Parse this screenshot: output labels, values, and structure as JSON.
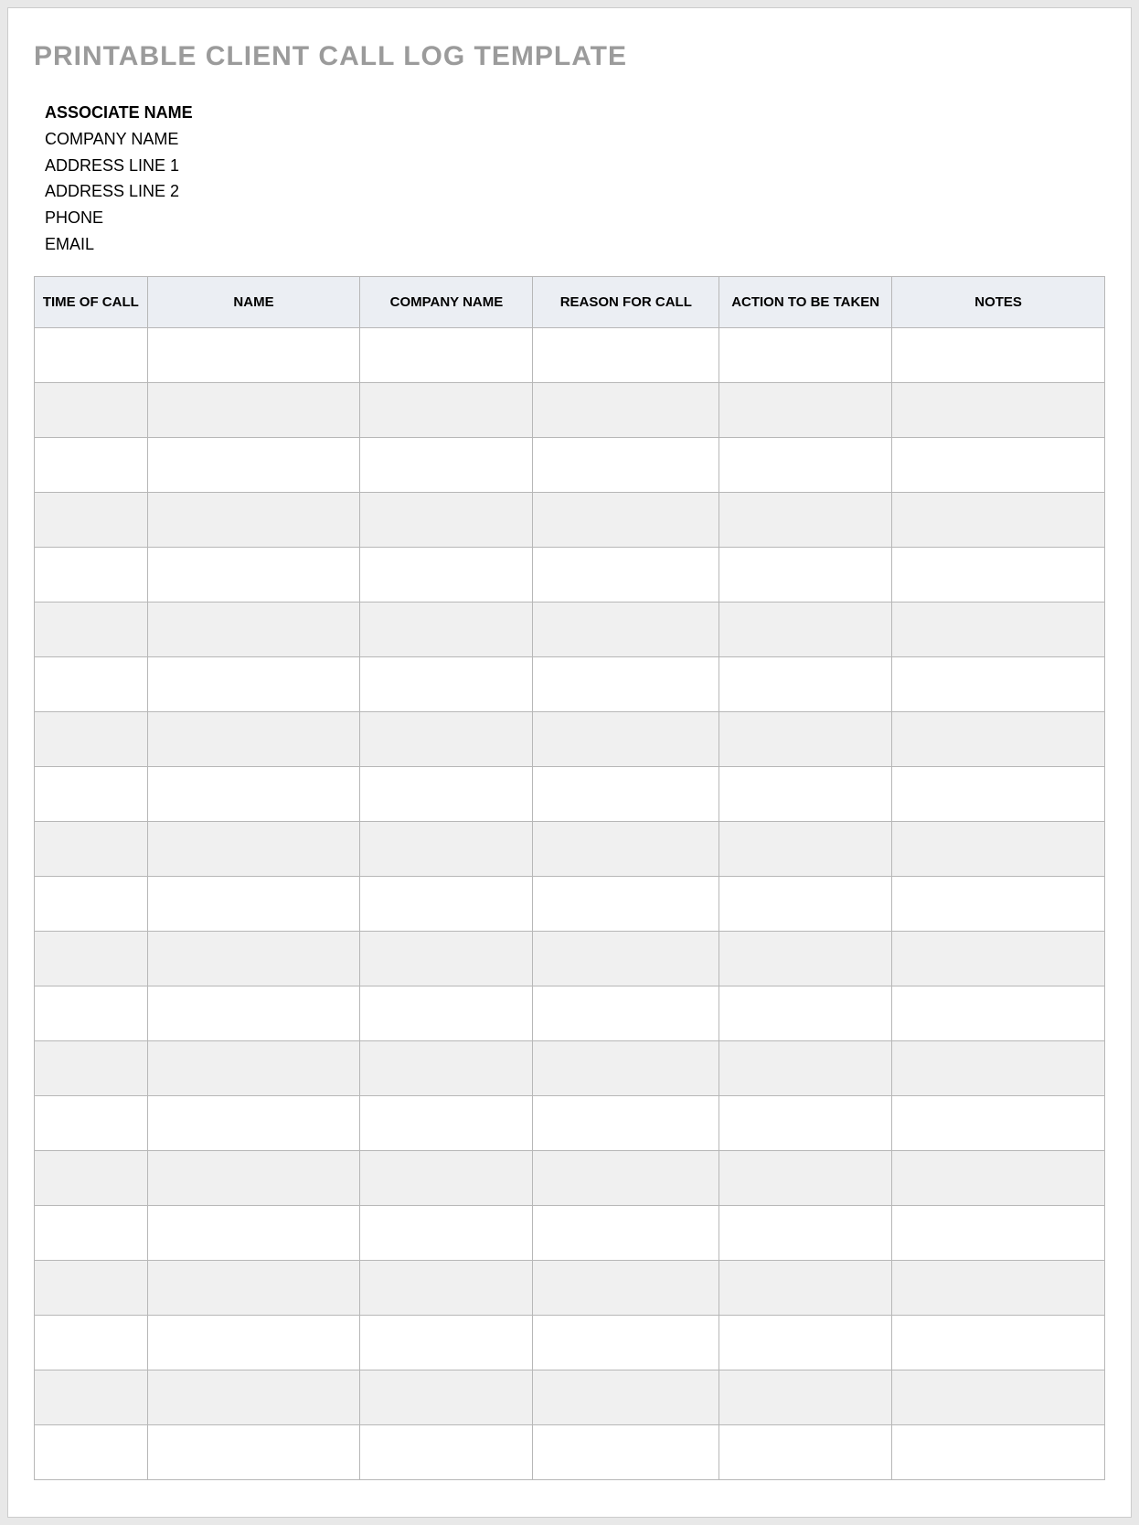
{
  "title": "PRINTABLE CLIENT CALL LOG TEMPLATE",
  "info": {
    "associate": "ASSOCIATE NAME",
    "company": "COMPANY NAME",
    "address1": "ADDRESS LINE 1",
    "address2": "ADDRESS LINE 2",
    "phone": "PHONE",
    "email": "EMAIL"
  },
  "columns": {
    "time": "TIME OF CALL",
    "name": "NAME",
    "company": "COMPANY NAME",
    "reason": "REASON FOR CALL",
    "action": "ACTION TO BE TAKEN",
    "notes": "NOTES"
  },
  "rowCount": 21
}
